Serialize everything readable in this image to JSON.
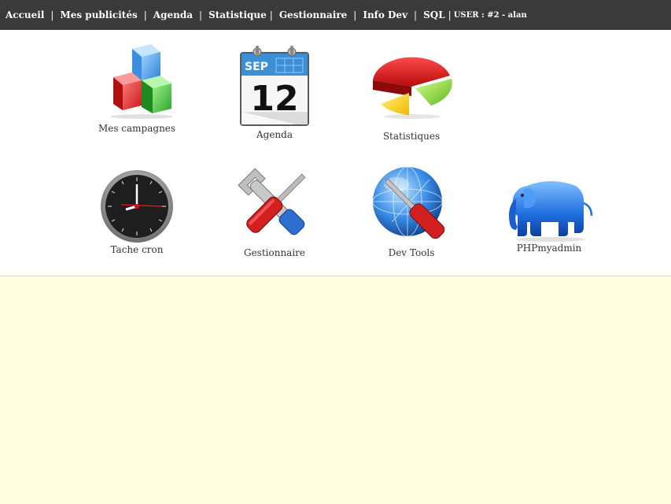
{
  "nav": {
    "items": [
      {
        "label": "Accueil"
      },
      {
        "label": "Mes publicités"
      },
      {
        "label": "Agenda"
      },
      {
        "label": "Statistique"
      },
      {
        "label": "Gestionnaire"
      },
      {
        "label": "Info Dev"
      },
      {
        "label": "SQL"
      }
    ],
    "user_text": "USER : #2 - alan"
  },
  "tiles": {
    "campaigns": {
      "label": "Mes campagnes",
      "icon": "cubes-icon"
    },
    "agenda": {
      "label": "Agenda",
      "icon": "calendar-icon",
      "month": "SEP",
      "day": "12"
    },
    "stats": {
      "label": "Statistiques",
      "icon": "pie-chart-icon"
    },
    "cron": {
      "label": "Tache cron",
      "icon": "clock-icon"
    },
    "manager": {
      "label": "Gestionnaire",
      "icon": "tools-icon"
    },
    "devtools": {
      "label": "Dev Tools",
      "icon": "globe-screwdriver-icon"
    },
    "phpmyadmin": {
      "label": "PHPmyadmin",
      "icon": "elephant-icon"
    }
  },
  "colors": {
    "topbar_bg": "#3a3a3a",
    "content_bg": "#ffffe0"
  }
}
